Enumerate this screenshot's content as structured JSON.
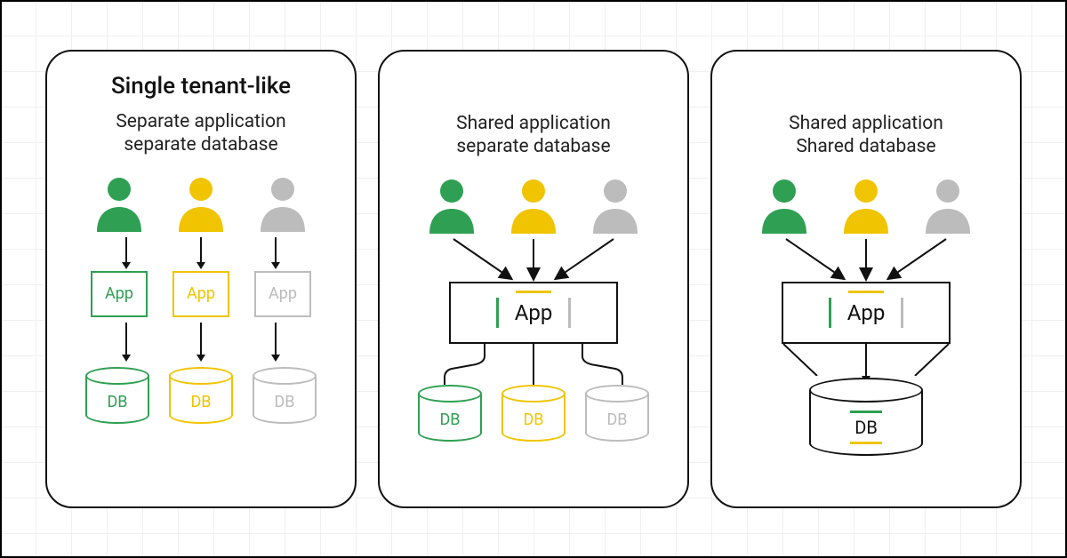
{
  "colors": {
    "green": "#2fa053",
    "yellow": "#f0c400",
    "gray": "#bcbcbc",
    "black": "#111111"
  },
  "labels": {
    "app": "App",
    "db": "DB"
  },
  "panels": [
    {
      "id": "single-tenant",
      "title": "Single tenant-like",
      "subtitle_line1": "Separate application",
      "subtitle_line2": "separate database",
      "users": [
        "green",
        "yellow",
        "gray"
      ],
      "apps": [
        {
          "color": "green",
          "label": "App"
        },
        {
          "color": "yellow",
          "label": "App"
        },
        {
          "color": "gray",
          "label": "App"
        }
      ],
      "dbs": [
        {
          "color": "green",
          "label": "DB"
        },
        {
          "color": "yellow",
          "label": "DB"
        },
        {
          "color": "gray",
          "label": "DB"
        }
      ]
    },
    {
      "id": "shared-app-sep-db",
      "title": "",
      "subtitle_line1": "Shared application",
      "subtitle_line2": "separate database",
      "users": [
        "green",
        "yellow",
        "gray"
      ],
      "shared_app_label": "App",
      "dbs": [
        {
          "color": "green",
          "label": "DB"
        },
        {
          "color": "yellow",
          "label": "DB"
        },
        {
          "color": "gray",
          "label": "DB"
        }
      ]
    },
    {
      "id": "shared-app-shared-db",
      "title": "",
      "subtitle_line1": "Shared application",
      "subtitle_line2": "Shared database",
      "users": [
        "green",
        "yellow",
        "gray"
      ],
      "shared_app_label": "App",
      "shared_db_label": "DB"
    }
  ]
}
